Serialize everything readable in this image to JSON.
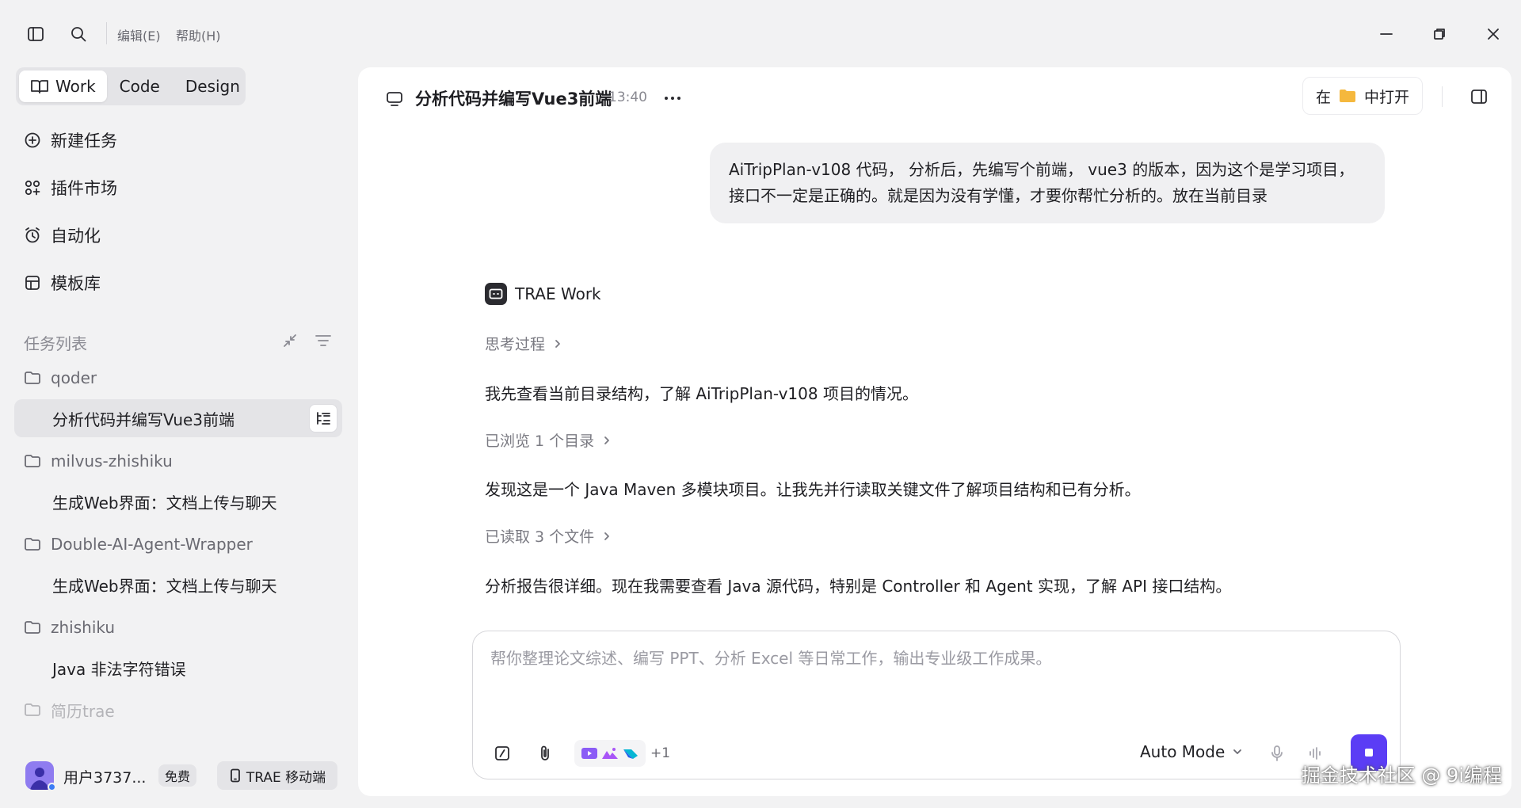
{
  "titlebar": {
    "menu_edit": "编辑(E)",
    "menu_help": "帮助(H)"
  },
  "modes": [
    "Work",
    "Code",
    "Design"
  ],
  "sidebar": {
    "nav": {
      "new_task": "新建任务",
      "plugins": "插件市场",
      "automation": "自动化",
      "templates": "模板库"
    },
    "task_list_label": "任务列表",
    "groups": {
      "g1": "qoder",
      "g1_t1": "分析代码并编写Vue3前端",
      "g2": "milvus-zhishiku",
      "g2_t1": "生成Web界面：文档上传与聊天",
      "g3": "Double-AI-Agent-Wrapper",
      "g3_t1": "生成Web界面：文档上传与聊天",
      "g4": "zhishiku",
      "g4_t1": "Java 非法字符错误",
      "g5": "简历trae"
    },
    "user": {
      "name": "用户3737...",
      "plan": "免费",
      "mobile": "TRAE 移动端"
    }
  },
  "chat": {
    "title": "分析代码并编写Vue3前端",
    "time": "13:40",
    "open_in_prefix": "在",
    "open_in_suffix": "中打开",
    "user_message_line1": "AiTripPlan-v108  代码，  分析后，先编写个前端，  vue3 的版本，因为这个是学习项目，",
    "user_message_line2": "接口不一定是正确的。就是因为没有学懂，才要你帮忙分析的。放在当前目录",
    "assistant_name": "TRAE Work",
    "thinking": "思考过程",
    "msg1": "我先查看当前目录结构，了解 AiTripPlan-v108 项目的情况。",
    "browsed": "已浏览 1 个目录",
    "msg2": "发现这是一个 Java Maven 多模块项目。让我先并行读取关键文件了解项目结构和已有分析。",
    "read_files": "已读取 3 个文件",
    "msg3": "分析报告很详细。现在我需要查看 Java 源代码，特别是 Controller 和 Agent 实现，了解 API 接口结构。"
  },
  "composer": {
    "placeholder": "帮你整理论文综述、编写 PPT、分析 Excel 等日常工作，输出专业级工作成果。",
    "extra_count": "+1",
    "mode": "Auto Mode"
  },
  "watermark": "掘金技术社区 @ 9i编程",
  "colors": {
    "accent": "#5b3df5",
    "folder": "#f5b83d",
    "sidebar_bg": "#f2f2f3",
    "panel_bg": "#ffffff"
  }
}
